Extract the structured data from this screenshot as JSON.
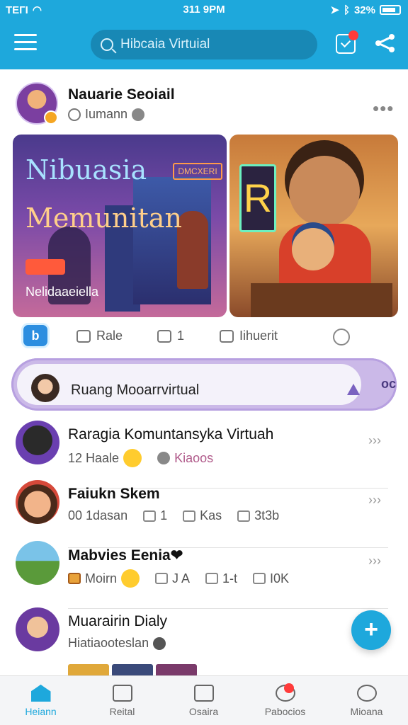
{
  "status_bar": {
    "carrier": "TEГI",
    "time": "311 9PM",
    "battery": "32%"
  },
  "header": {
    "search_placeholder": "Hibcaia Virtuial"
  },
  "post": {
    "author": "Nauarie Seoiail",
    "subtitle": "Iumann",
    "media_left": {
      "title_line1": "Nibuasia",
      "title_line2": "Memunitan",
      "neon_sign": "DMCXERI",
      "caption": "Nelidaaeiella"
    },
    "actions": [
      {
        "label": "Rale"
      },
      {
        "label": "1"
      },
      {
        "label": "Iihuerit"
      }
    ]
  },
  "room": {
    "label": "Ruang Mooarrvirtual",
    "end_text": "oc"
  },
  "list": [
    {
      "name": "Raragia Komuntansyka Virtuah",
      "meta": [
        "12 Haale",
        "Kiaoos"
      ]
    },
    {
      "name": "Faiukn Skem",
      "meta": [
        "00 1dasan",
        "1",
        "Kas",
        "3t3b"
      ]
    },
    {
      "name": "Mabvies Eenia❤",
      "meta": [
        "Moirn",
        "J A",
        "1-t",
        "I0K"
      ]
    },
    {
      "name": "Muarairin Dialy",
      "meta": [
        "Hiatiaooteslan"
      ]
    }
  ],
  "bottom_nav": [
    {
      "label": "Heiann",
      "icon": "home-icon",
      "active": true
    },
    {
      "label": "Reital",
      "icon": "list-icon",
      "active": false
    },
    {
      "label": "Osaira",
      "icon": "camera-icon",
      "active": false
    },
    {
      "label": "Pabocios",
      "icon": "bell-icon",
      "active": false
    },
    {
      "label": "Mioana",
      "icon": "profile-icon",
      "active": false
    }
  ],
  "colors": {
    "accent": "#1ea8dc",
    "room_bg": "#cbb9e8",
    "badge": "#ff3b3b"
  }
}
